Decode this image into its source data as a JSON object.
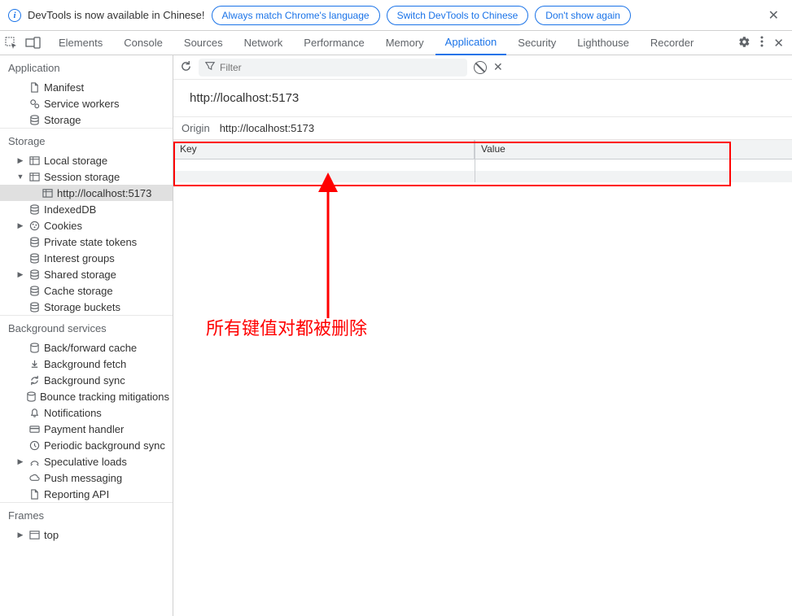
{
  "infobar": {
    "text": "DevTools is now available in Chinese!",
    "btn1": "Always match Chrome's language",
    "btn2": "Switch DevTools to Chinese",
    "btn3": "Don't show again"
  },
  "tabs": {
    "elements": "Elements",
    "console": "Console",
    "sources": "Sources",
    "network": "Network",
    "performance": "Performance",
    "memory": "Memory",
    "application": "Application",
    "security": "Security",
    "lighthouse": "Lighthouse",
    "recorder": "Recorder"
  },
  "sidebar": {
    "application": {
      "title": "Application",
      "manifest": "Manifest",
      "service_workers": "Service workers",
      "storage": "Storage"
    },
    "storage": {
      "title": "Storage",
      "local_storage": "Local storage",
      "session_storage": "Session storage",
      "session_origin": "http://localhost:5173",
      "indexeddb": "IndexedDB",
      "cookies": "Cookies",
      "private_state_tokens": "Private state tokens",
      "interest_groups": "Interest groups",
      "shared_storage": "Shared storage",
      "cache_storage": "Cache storage",
      "storage_buckets": "Storage buckets"
    },
    "bg": {
      "title": "Background services",
      "bfcache": "Back/forward cache",
      "bg_fetch": "Background fetch",
      "bg_sync": "Background sync",
      "bounce": "Bounce tracking mitigations",
      "notifications": "Notifications",
      "payment": "Payment handler",
      "periodic": "Periodic background sync",
      "speculative": "Speculative loads",
      "push": "Push messaging",
      "reporting": "Reporting API"
    },
    "frames": {
      "title": "Frames",
      "top": "top"
    }
  },
  "content": {
    "filter_placeholder": "Filter",
    "title": "http://localhost:5173",
    "origin_label": "Origin",
    "origin_value": "http://localhost:5173",
    "col_key": "Key",
    "col_value": "Value"
  },
  "annotation": {
    "text": "所有键值对都被删除"
  }
}
